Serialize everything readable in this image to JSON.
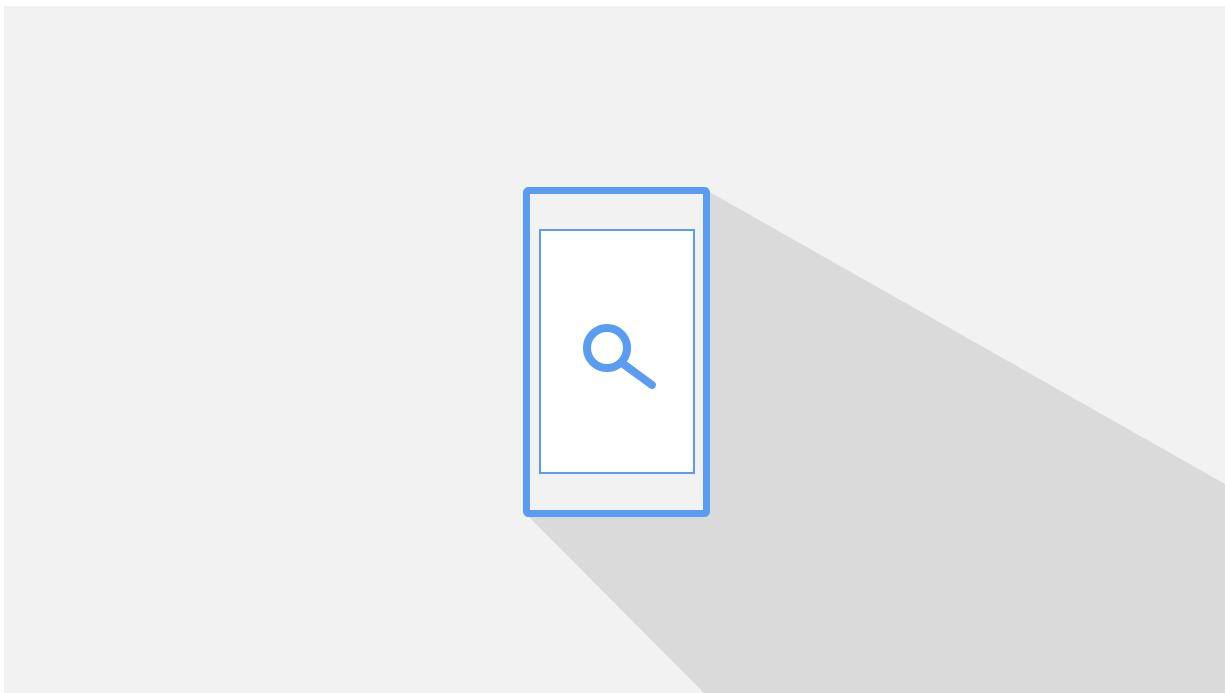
{
  "colors": {
    "background": "#f2f2f2",
    "shadow": "#dadada",
    "accent": "#5b9cf3",
    "screen": "#ffffff"
  },
  "icons": {
    "device": "smartphone-icon",
    "search": "search-icon"
  }
}
